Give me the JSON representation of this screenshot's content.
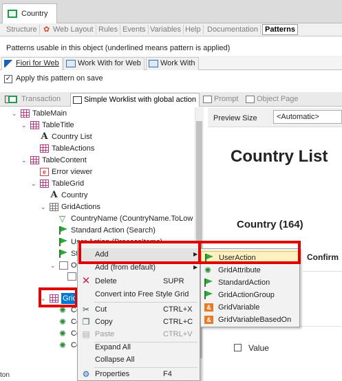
{
  "window": {
    "tab_title": "Country"
  },
  "part_tabs": [
    "Structure",
    "Web Layout",
    "Rules",
    "Events",
    "Variables",
    "Help",
    "Documentation",
    "Patterns"
  ],
  "patterns_description": "Patterns usable in this object (underlined means pattern is applied)",
  "pattern_tabs": [
    "Fiori for Web",
    "Work With for Web",
    "Work With"
  ],
  "apply_checkbox": {
    "label": "Apply this pattern on save",
    "checked": true
  },
  "instance_tabs": [
    "Transaction",
    "Simple Worklist with global action",
    "Prompt",
    "Object Page"
  ],
  "tree": {
    "nodes": [
      "TableMain",
      "TableTitle",
      "Country List",
      "TableActions",
      "TableContent",
      "Error viewer",
      "TableGrid",
      "Country",
      "GridActions",
      "CountryName (CountryName.ToLow",
      "Standard Action (Search)",
      "User Action (ProcessItems)",
      "St",
      "Or",
      "Grid",
      "Co",
      "Co",
      "Co",
      "Co"
    ]
  },
  "preview": {
    "size_label": "Preview Size",
    "size_value": "<Automatic>",
    "title": "Country List",
    "count": "Country (164)",
    "confirm": "Confirm",
    "value_label": "Value"
  },
  "context_menu": {
    "items": [
      {
        "label": "Add",
        "shortcut": "",
        "submenu": true
      },
      {
        "label": "Add (from default)",
        "shortcut": "",
        "submenu": true
      },
      {
        "label": "Delete",
        "shortcut": "SUPR",
        "icon": "delete-icon"
      },
      {
        "label": "Convert into Free Style Grid",
        "shortcut": ""
      },
      {
        "label": "Cut",
        "shortcut": "CTRL+X",
        "icon": "cut-icon"
      },
      {
        "label": "Copy",
        "shortcut": "CTRL+C",
        "icon": "copy-icon"
      },
      {
        "label": "Paste",
        "shortcut": "CTRL+V",
        "icon": "paste-icon",
        "disabled": true
      },
      {
        "label": "Expand All",
        "shortcut": ""
      },
      {
        "label": "Collapse All",
        "shortcut": ""
      },
      {
        "label": "Properties",
        "shortcut": "F4",
        "icon": "properties-icon"
      }
    ]
  },
  "submenu": {
    "items": [
      "UserAction",
      "GridAttribute",
      "StandardAction",
      "GridActionGroup",
      "GridVariable",
      "GridVariableBasedOn"
    ]
  },
  "status_bar": {
    "text": "ton"
  }
}
